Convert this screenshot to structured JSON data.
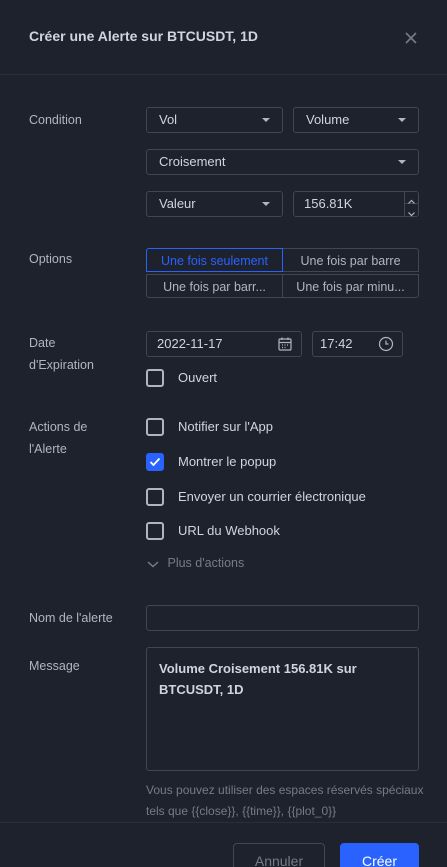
{
  "dialog": {
    "title": "Créer une Alerte sur BTCUSDT, 1D"
  },
  "condition": {
    "label": "Condition",
    "source": "Vol",
    "source_plot": "Volume",
    "operator": "Croisement",
    "value_type": "Valeur",
    "value": "156.81K"
  },
  "options": {
    "label": "Options",
    "choices": [
      "Une fois seulement",
      "Une fois par barre",
      "Une fois par barr...",
      "Une fois par minu..."
    ],
    "selected": "Une fois seulement"
  },
  "expiration": {
    "label_line1": "Date",
    "label_line2": "d'Expiration",
    "date": "2022-11-17",
    "time": "17:42",
    "open_label": "Ouvert",
    "open_checked": false
  },
  "actions": {
    "label_line1": "Actions de",
    "label_line2": "l'Alerte",
    "items": [
      {
        "label": "Notifier sur l'App",
        "checked": false
      },
      {
        "label": "Montrer le popup",
        "checked": true
      },
      {
        "label": "Envoyer un courrier électronique",
        "checked": false
      },
      {
        "label": "URL du Webhook",
        "checked": false
      }
    ],
    "more_label": "Plus d'actions"
  },
  "alert_name": {
    "label": "Nom de l'alerte",
    "value": ""
  },
  "message": {
    "label": "Message",
    "value": "Volume Croisement 156.81K sur BTCUSDT, 1D",
    "hint": "Vous pouvez utiliser des espaces réservés spéciaux tels que {{close}}, {{time}}, {{plot_0}}"
  },
  "footer": {
    "cancel_label": "Annuler",
    "create_label": "Créer"
  },
  "colors": {
    "background": "#1e222d",
    "accent": "#2962ff",
    "border": "#434651",
    "text": "#d1d4dc",
    "muted": "#787b86"
  }
}
